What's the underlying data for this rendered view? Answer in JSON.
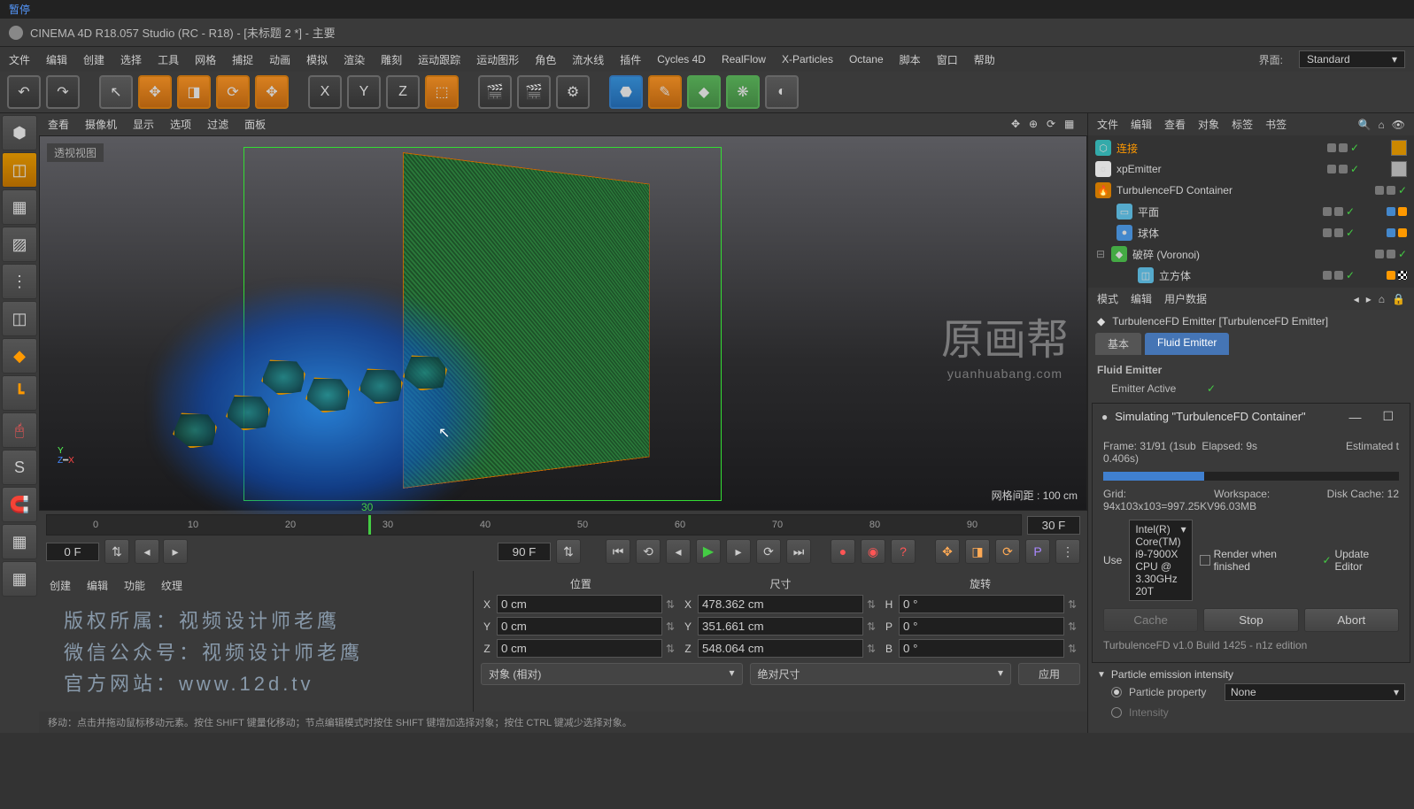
{
  "pause": "暂停",
  "title": "CINEMA 4D R18.057 Studio (RC - R18) - [未标题 2 *] - 主要",
  "menu": [
    "文件",
    "编辑",
    "创建",
    "选择",
    "工具",
    "网格",
    "捕捉",
    "动画",
    "模拟",
    "渲染",
    "雕刻",
    "运动跟踪",
    "运动图形",
    "角色",
    "流水线",
    "插件",
    "Cycles 4D",
    "RealFlow",
    "X-Particles",
    "Octane",
    "脚本",
    "窗口",
    "帮助"
  ],
  "layout_label": "界面:",
  "layout_value": "Standard",
  "viewport_menu": [
    "查看",
    "摄像机",
    "显示",
    "选项",
    "过滤",
    "面板"
  ],
  "viewport_label": "透视视图",
  "grid_distance": "网格间距 : 100 cm",
  "watermark": "原画帮",
  "watermark_sub": "yuanhuabang.com",
  "timeline_ticks": [
    "0",
    "10",
    "20",
    "30",
    "40",
    "50",
    "60",
    "70",
    "80",
    "90"
  ],
  "timeline_current": "30",
  "frame_display": "30 F",
  "range_start": "0 F",
  "range_end": "90 F",
  "materials_tabs": [
    "创建",
    "编辑",
    "功能",
    "纹理"
  ],
  "credits": {
    "l1": "版权所属：视频设计师老鹰",
    "l2": "微信公众号：视频设计师老鹰",
    "l3": "官方网站：www.12d.tv"
  },
  "coords": {
    "headers": [
      "位置",
      "尺寸",
      "旋转"
    ],
    "rows": [
      {
        "axis": "X",
        "pos": "0 cm",
        "size": "478.362 cm",
        "rlabel": "H",
        "rot": "0 °"
      },
      {
        "axis": "Y",
        "pos": "0 cm",
        "size": "351.661 cm",
        "rlabel": "P",
        "rot": "0 °"
      },
      {
        "axis": "Z",
        "pos": "0 cm",
        "size": "548.064 cm",
        "rlabel": "B",
        "rot": "0 °"
      }
    ],
    "mode1": "对象 (相对)",
    "mode2": "绝对尺寸",
    "apply": "应用"
  },
  "objmgr_tabs": [
    "文件",
    "编辑",
    "查看",
    "对象",
    "标签",
    "书签"
  ],
  "objects": [
    {
      "name": "连接",
      "icon": "cyan",
      "sel": true
    },
    {
      "name": "xpEmitter",
      "icon": "white"
    },
    {
      "name": "TurbulenceFD Container",
      "icon": "orange"
    },
    {
      "name": "平面",
      "icon": "lblue",
      "indent": 1
    },
    {
      "name": "球体",
      "icon": "blue",
      "indent": 1
    },
    {
      "name": "破碎  (Voronoi)",
      "icon": "green",
      "tree": "⊟"
    },
    {
      "name": "立方体",
      "icon": "lblue",
      "indent": 2
    }
  ],
  "attr_tabs": [
    "模式",
    "编辑",
    "用户数据"
  ],
  "attr_object": "TurbulenceFD Emitter [TurbulenceFD Emitter]",
  "attr_subtabs": {
    "basic": "基本",
    "fluid": "Fluid Emitter"
  },
  "fluid_group": "Fluid Emitter",
  "emitter_active": "Emitter Active",
  "sim": {
    "title": "Simulating \"TurbulenceFD Container\"",
    "frame": "Frame: 31/91 (1sub 0.406s)",
    "elapsed": "Elapsed: 9s",
    "estimated": "Estimated t",
    "progress_pct": 34,
    "grid": "Grid: 94x103x103=997.25KV",
    "workspace": "Workspace: 96.03MB",
    "diskcache": "Disk Cache: 12",
    "use_label": "Use",
    "cpu": "Intel(R) Core(TM) i9-7900X CPU @ 3.30GHz 20T",
    "render_when": "Render when finished",
    "update_editor": "Update Editor",
    "btn_cache": "Cache",
    "btn_stop": "Stop",
    "btn_abort": "Abort",
    "version": "TurbulenceFD v1.0 Build 1425 - n1z edition"
  },
  "particle_sec": "Particle emission intensity",
  "particle_prop_label": "Particle property",
  "particle_prop_value": "None",
  "intensity_label": "Intensity",
  "status": "移动：点击并拖动鼠标移动元素。按住 SHIFT 键量化移动；节点编辑模式时按住 SHIFT 键增加选择对象；按住 CTRL 键减少选择对象。"
}
